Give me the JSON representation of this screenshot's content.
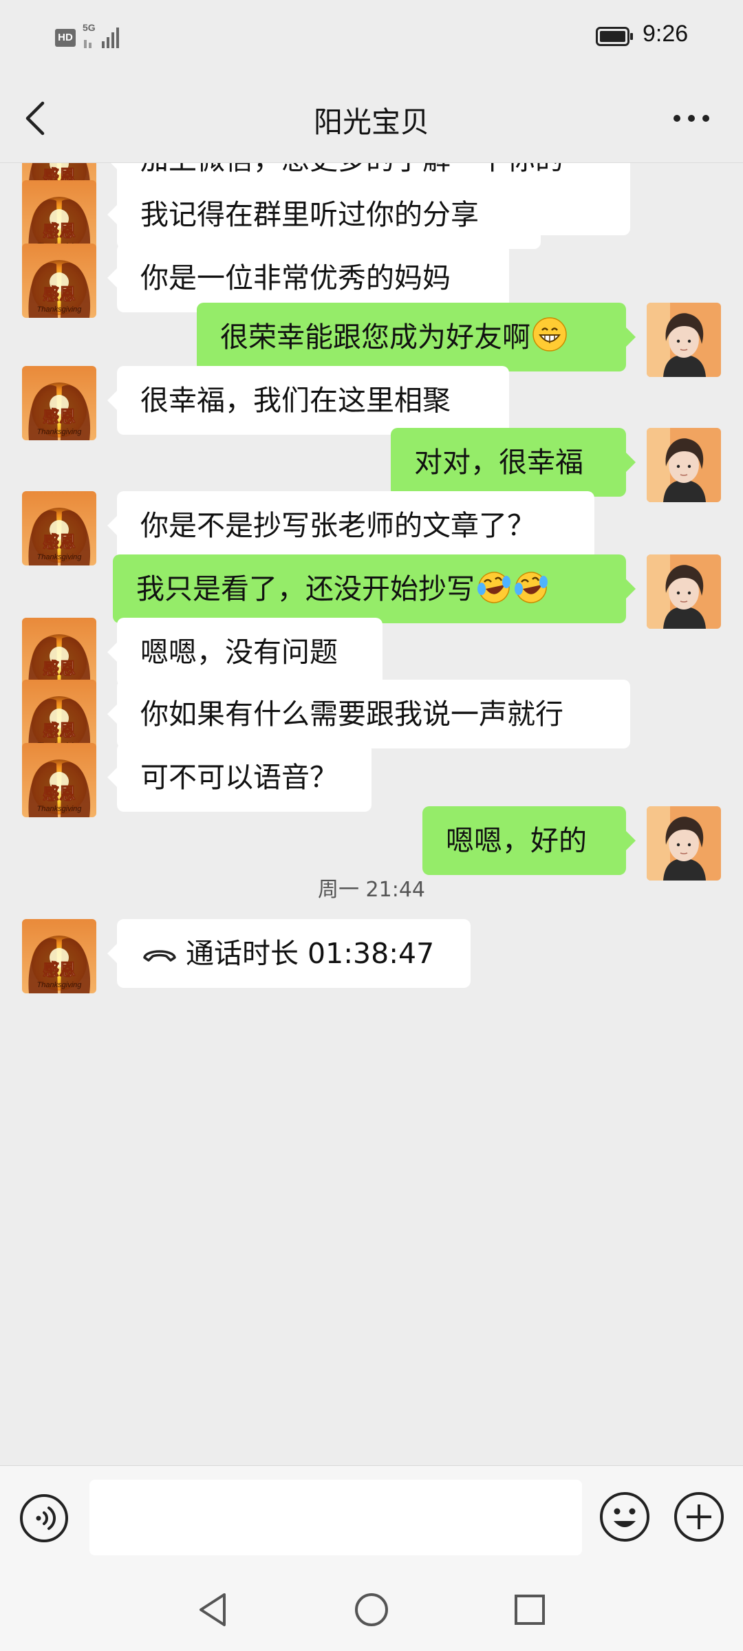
{
  "status_bar": {
    "hd_label": "HD",
    "network_label": "5G",
    "time": "9:26"
  },
  "header": {
    "title": "阳光宝贝"
  },
  "messages": [
    {
      "side": "in",
      "text": "加上微信，想更多的了解一下你的\n情况"
    },
    {
      "side": "in",
      "text": "我记得在群里听过你的分享"
    },
    {
      "side": "in",
      "text": "你是一位非常优秀的妈妈"
    },
    {
      "side": "out",
      "text": "很荣幸能跟您成为好友啊",
      "emoji": [
        "grinning"
      ]
    },
    {
      "side": "in",
      "text": "很幸福，我们在这里相聚"
    },
    {
      "side": "out",
      "text": "对对，很幸福"
    },
    {
      "side": "in",
      "text": "你是不是抄写张老师的文章了？"
    },
    {
      "side": "out",
      "text": "我只是看了，还没开始抄写",
      "emoji": [
        "laughing-tears",
        "laughing-tears"
      ]
    },
    {
      "side": "in",
      "text": "嗯嗯，没有问题"
    },
    {
      "side": "in",
      "text": "你如果有什么需要跟我说一声就行"
    },
    {
      "side": "in",
      "text": "可不可以语音？"
    },
    {
      "side": "out",
      "text": "嗯嗯，好的"
    },
    {
      "type": "time",
      "text": "周一 21:44"
    },
    {
      "side": "in",
      "type": "call",
      "text": "通话时长 01:38:47"
    }
  ],
  "avatars": {
    "contact_caption": "感恩",
    "contact_subcaption": "Thanksgiving"
  },
  "input": {
    "placeholder": ""
  },
  "colors": {
    "background": "#ededed",
    "incoming_bubble": "#ffffff",
    "outgoing_bubble": "#95ec69"
  }
}
